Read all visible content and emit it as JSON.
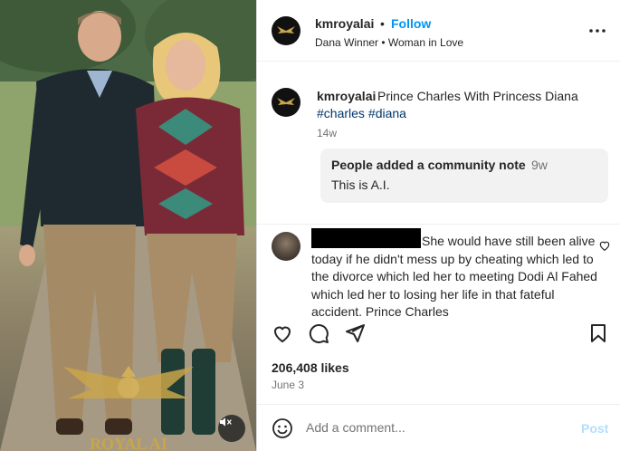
{
  "post": {
    "username": "kmroyalai",
    "separator": "•",
    "follow_label": "Follow",
    "audio": "Dana Winner • Woman in Love",
    "more_icon": "more-horizontal-icon"
  },
  "caption": {
    "username": "kmroyalai",
    "text": "Prince Charles With Princess Diana",
    "hashtags": [
      "#charles",
      "#diana"
    ],
    "time": "14w"
  },
  "community_note": {
    "title": "People added a community note",
    "time": "9w",
    "body": "This is A.I."
  },
  "comment": {
    "text": "She would have still been alive today if he didn't mess up by cheating which led to the divorce which led her to meeting Dodi Al Fahed which led her to losing her life in that fateful accident. Prince Charles"
  },
  "stats": {
    "likes": "206,408 likes",
    "date": "June 3"
  },
  "add_comment": {
    "placeholder": "Add a comment...",
    "post_label": "Post"
  },
  "media": {
    "watermark": "ROYAL AI",
    "mute_icon": "speaker-muted-icon"
  },
  "colors": {
    "accent": "#0095f6",
    "hashtag": "#00376b",
    "post_disabled": "#b2dffc",
    "muted_text": "#737373"
  }
}
